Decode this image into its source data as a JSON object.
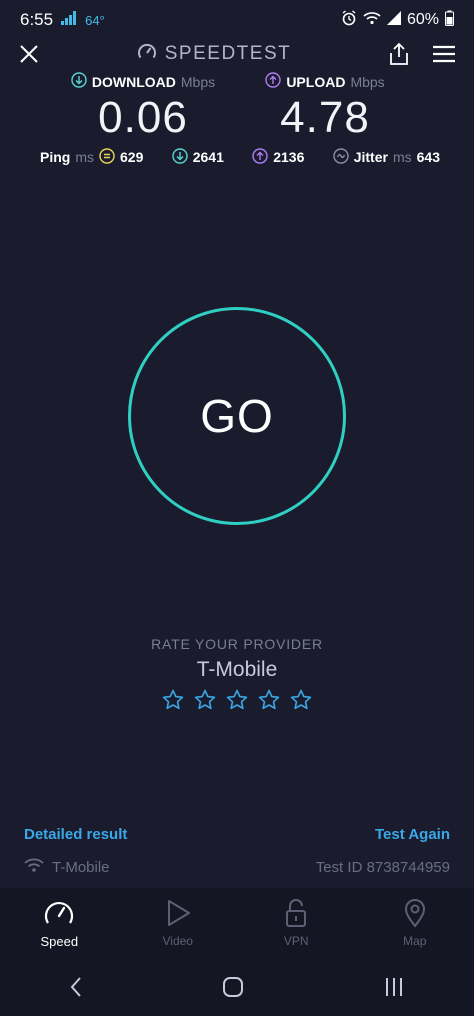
{
  "status_bar": {
    "time": "6:55",
    "temperature": "64°",
    "battery": "60%"
  },
  "header": {
    "title": "SPEEDTEST"
  },
  "download": {
    "label": "DOWNLOAD",
    "unit": "Mbps",
    "value": "0.06"
  },
  "upload": {
    "label": "UPLOAD",
    "unit": "Mbps",
    "value": "4.78"
  },
  "metrics": {
    "ping_label": "Ping",
    "ping_unit": "ms",
    "ping_value": "629",
    "download_latency": "2641",
    "upload_latency": "2136",
    "jitter_label": "Jitter",
    "jitter_unit": "ms",
    "jitter_value": "643"
  },
  "go_button": {
    "label": "GO"
  },
  "rating": {
    "heading": "RATE YOUR PROVIDER",
    "provider": "T-Mobile",
    "stars": 5,
    "filled": 0
  },
  "links": {
    "detailed_result": "Detailed result",
    "test_again": "Test Again"
  },
  "info": {
    "network": "T-Mobile",
    "test_id": "Test ID 8738744959"
  },
  "nav": [
    {
      "label": "Speed",
      "icon": "speedometer-icon",
      "active": true
    },
    {
      "label": "Video",
      "icon": "play-icon",
      "active": false
    },
    {
      "label": "VPN",
      "icon": "lock-icon",
      "active": false
    },
    {
      "label": "Map",
      "icon": "map-pin-icon",
      "active": false
    }
  ],
  "colors": {
    "accent_teal": "#2fd0c2",
    "download": "#55d6d0",
    "upload": "#b07cf0",
    "link": "#3aa8e6",
    "star": "#3aa8e6",
    "background": "#1a1c2e"
  }
}
